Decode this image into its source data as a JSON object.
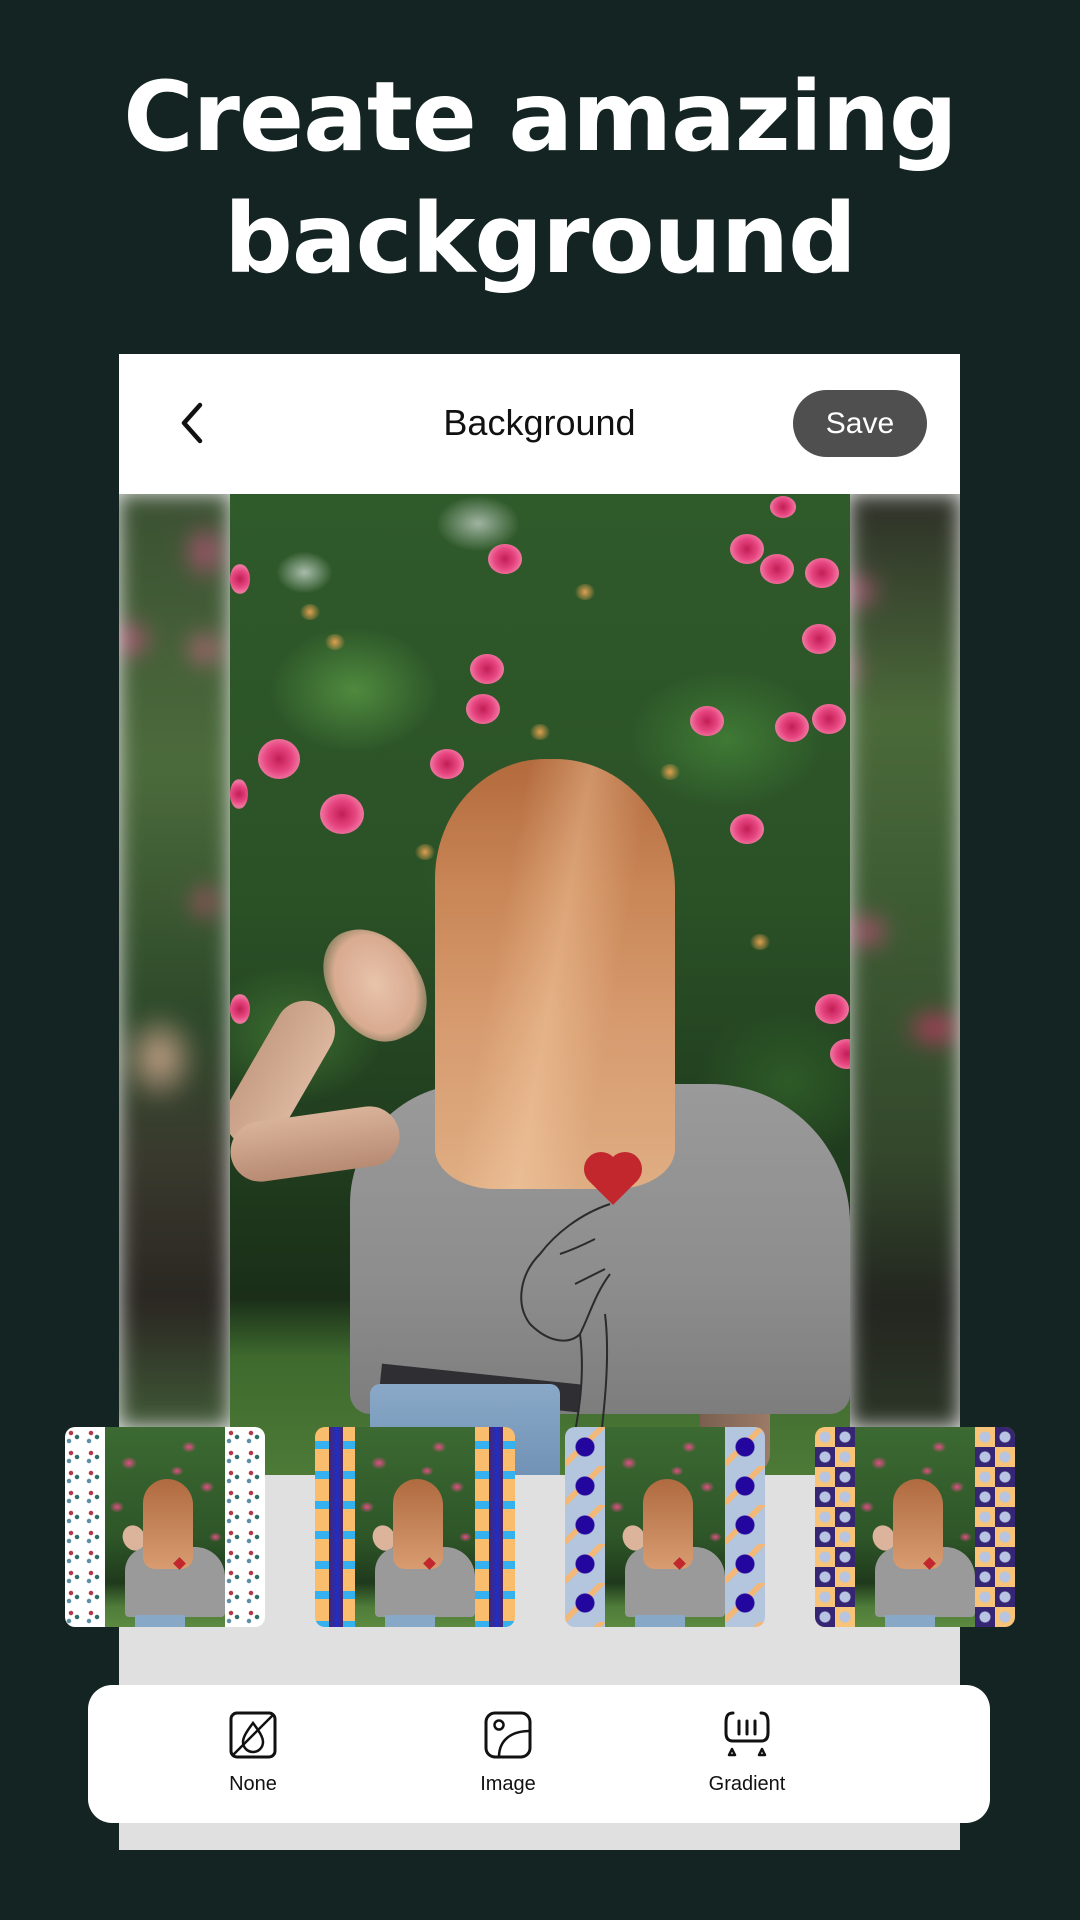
{
  "headline": {
    "line1": "Create amazing",
    "line2": "background"
  },
  "header": {
    "back_icon": "chevron-left-icon",
    "title": "Background",
    "save_label": "Save"
  },
  "colors": {
    "page_background": "#132423",
    "save_button": "#4f4f4f",
    "canvas_gray": "#e0e0e0"
  },
  "thumbnails": [
    {
      "pattern": "white-dots"
    },
    {
      "pattern": "orange-blue-plaid"
    },
    {
      "pattern": "blue-circles-zigzag"
    },
    {
      "pattern": "navy-orange-checker"
    }
  ],
  "toolbar": {
    "items": [
      {
        "label": "None",
        "icon": "no-background-icon"
      },
      {
        "label": "Image",
        "icon": "image-icon"
      },
      {
        "label": "Gradient",
        "icon": "gradient-icon"
      }
    ]
  }
}
